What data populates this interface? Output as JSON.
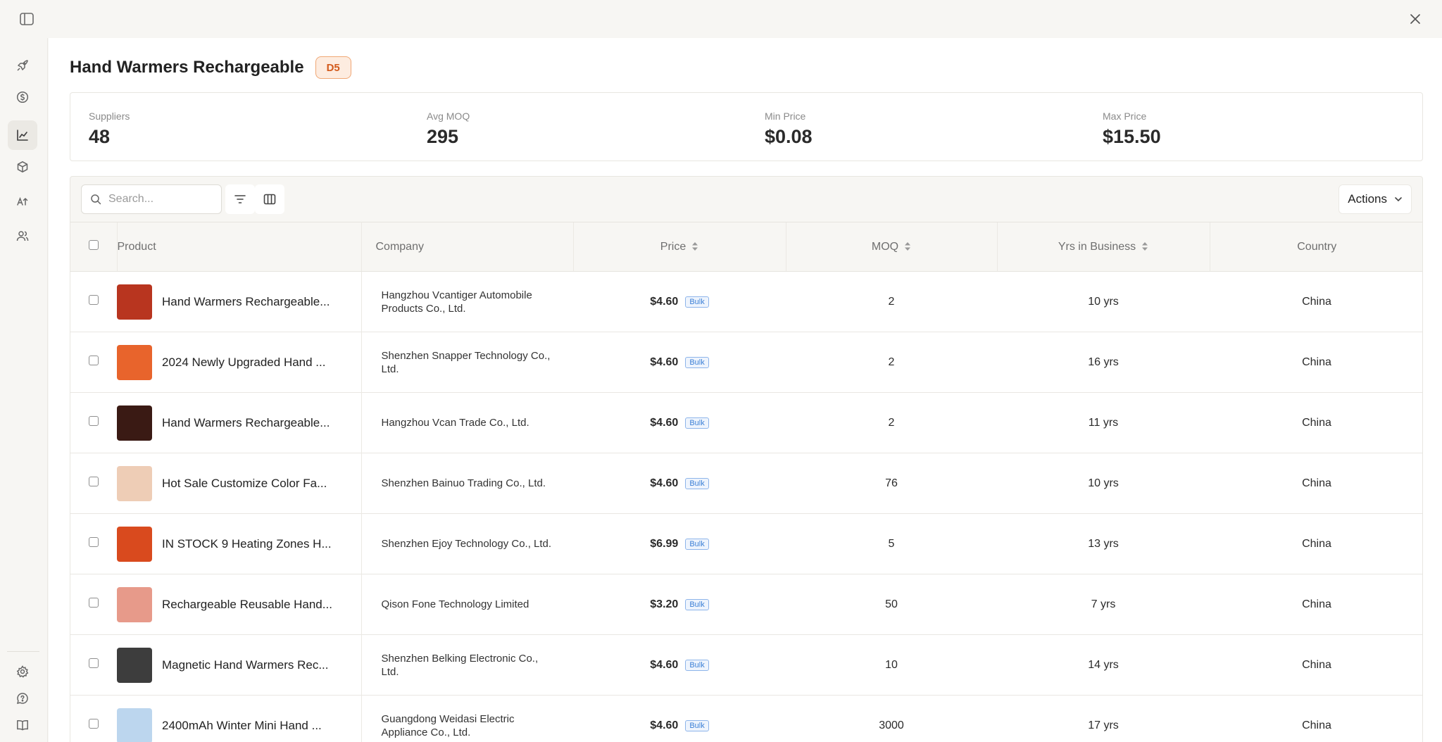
{
  "header": {
    "title": "Hand Warmers Rechargeable",
    "badge": "D5"
  },
  "stats": [
    {
      "label": "Suppliers",
      "value": "48"
    },
    {
      "label": "Avg MOQ",
      "value": "295"
    },
    {
      "label": "Min Price",
      "value": "$0.08"
    },
    {
      "label": "Max Price",
      "value": "$15.50"
    }
  ],
  "toolbar": {
    "search_placeholder": "Search...",
    "actions_label": "Actions"
  },
  "table": {
    "columns": {
      "product": "Product",
      "company": "Company",
      "price": "Price",
      "moq": "MOQ",
      "yrs": "Yrs in Business",
      "country": "Country"
    },
    "rows": [
      {
        "product": "Hand Warmers Rechargeable...",
        "company": "Hangzhou Vcantiger Automobile Products Co., Ltd.",
        "price": "$4.60",
        "tag": "Bulk",
        "moq": "2",
        "yrs": "10 yrs",
        "country": "China",
        "thumb": "#b8351f"
      },
      {
        "product": "2024 Newly Upgraded Hand ...",
        "company": "Shenzhen Snapper Technology Co., Ltd.",
        "price": "$4.60",
        "tag": "Bulk",
        "moq": "2",
        "yrs": "16 yrs",
        "country": "China",
        "thumb": "#e8642c"
      },
      {
        "product": "Hand Warmers Rechargeable...",
        "company": "Hangzhou Vcan Trade Co., Ltd.",
        "price": "$4.60",
        "tag": "Bulk",
        "moq": "2",
        "yrs": "11 yrs",
        "country": "China",
        "thumb": "#3a1a14"
      },
      {
        "product": "Hot Sale Customize Color Fa...",
        "company": "Shenzhen Bainuo Trading Co., Ltd.",
        "price": "$4.60",
        "tag": "Bulk",
        "moq": "76",
        "yrs": "10 yrs",
        "country": "China",
        "thumb": "#eecdb6"
      },
      {
        "product": "IN STOCK 9 Heating Zones H...",
        "company": "Shenzhen Ejoy Technology Co., Ltd.",
        "price": "$6.99",
        "tag": "Bulk",
        "moq": "5",
        "yrs": "13 yrs",
        "country": "China",
        "thumb": "#d94a1e"
      },
      {
        "product": "Rechargeable Reusable Hand...",
        "company": "Qison Fone Technology Limited",
        "price": "$3.20",
        "tag": "Bulk",
        "moq": "50",
        "yrs": "7 yrs",
        "country": "China",
        "thumb": "#e79a8a"
      },
      {
        "product": "Magnetic Hand Warmers Rec...",
        "company": "Shenzhen Belking Electronic Co., Ltd.",
        "price": "$4.60",
        "tag": "Bulk",
        "moq": "10",
        "yrs": "14 yrs",
        "country": "China",
        "thumb": "#3d3d3d"
      },
      {
        "product": "2400mAh Winter Mini Hand ...",
        "company": "Guangdong Weidasi Electric Appliance Co., Ltd.",
        "price": "$4.60",
        "tag": "Bulk",
        "moq": "3000",
        "yrs": "17 yrs",
        "country": "China",
        "thumb": "#bcd6ee"
      }
    ]
  },
  "sidebar": {
    "items": [
      "rocket-icon",
      "dollar-icon",
      "chart-icon",
      "box-icon",
      "text-size-icon",
      "users-icon"
    ],
    "footer": [
      "settings-icon",
      "help-icon",
      "book-icon"
    ]
  }
}
